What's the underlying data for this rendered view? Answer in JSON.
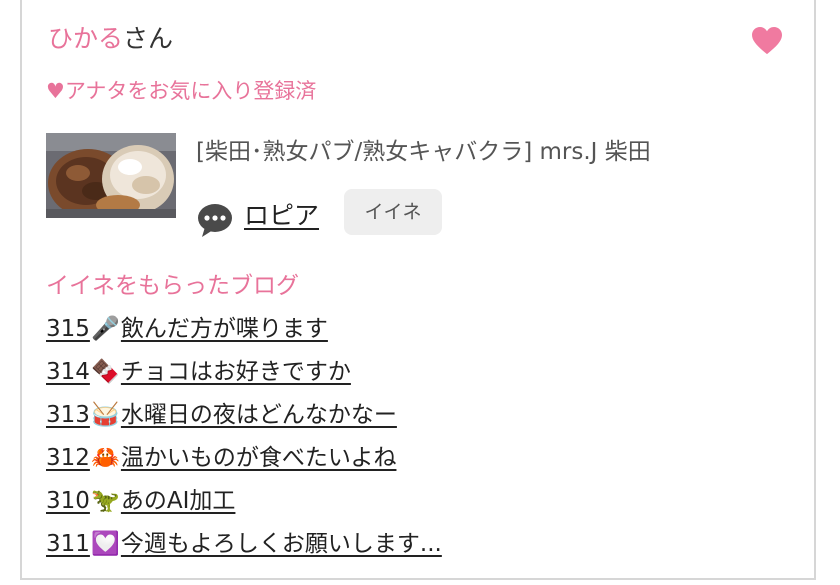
{
  "user": {
    "name": "ひかる",
    "suffix": "さん"
  },
  "favorite": {
    "status": "♥アナタをお気に入り登録済",
    "heart_icon": "heart-icon",
    "accent_color": "#e8739a"
  },
  "shop": {
    "info": "[柴田･熟女パブ/熟女キャバクラ]  mrs.J 柴田"
  },
  "liked_blog": {
    "title": "ロピア",
    "comment_icon": "speech-bubble-icon",
    "iine_label": "イイネ"
  },
  "received_section": {
    "heading": "イイネをもらったブログ",
    "items": [
      {
        "number": "315",
        "emoji": "🎤",
        "title": "飲んだ方が喋ります"
      },
      {
        "number": "314",
        "emoji": "🍫",
        "title": "チョコはお好きですか"
      },
      {
        "number": "313",
        "emoji": "🥁",
        "title": "水曜日の夜はどんなかなー"
      },
      {
        "number": "312",
        "emoji": "🦀",
        "title": "温かいものが食べたいよね"
      },
      {
        "number": "310",
        "emoji": "🦖",
        "title": "あのAI加工"
      },
      {
        "number": "311",
        "emoji": "💟",
        "title": "今週もよろしくお願いします..."
      }
    ]
  }
}
